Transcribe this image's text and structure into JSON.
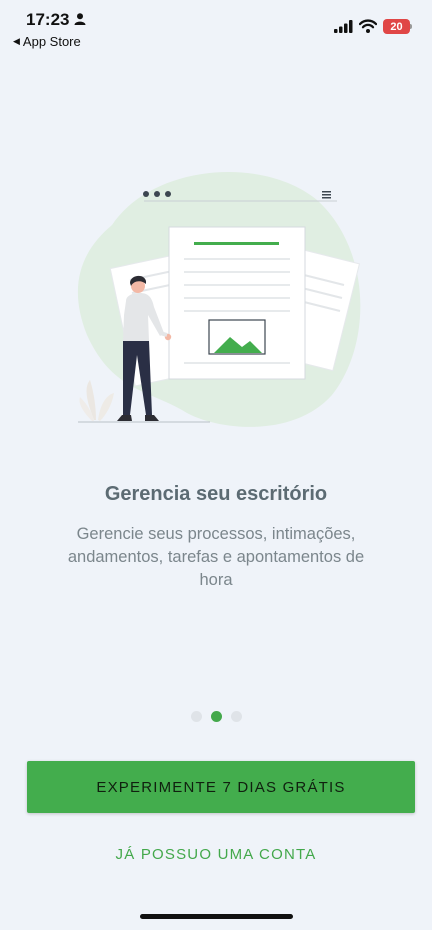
{
  "status_bar": {
    "time": "17:23",
    "back_label": "App Store",
    "battery_level": "20",
    "battery_color": "#e04646"
  },
  "illustration": {
    "icons": [
      "three-dots-icon",
      "hamburger-menu-icon",
      "document-icon",
      "image-placeholder-icon",
      "person-figure",
      "plant-icon"
    ]
  },
  "onboarding": {
    "title": "Gerencia seu escritório",
    "subtitle": "Gerencie seus processos, intimações, andamentos, tarefas e apontamentos de hora",
    "page_count": 3,
    "active_page": 2
  },
  "actions": {
    "trial_button_label": "EXPERIMENTE 7 DIAS GRÁTIS",
    "login_link_label": "JÁ POSSUO UMA CONTA"
  },
  "colors": {
    "background": "#eff3f9",
    "accent": "#43ad4d",
    "blob": "#e0eee2"
  }
}
